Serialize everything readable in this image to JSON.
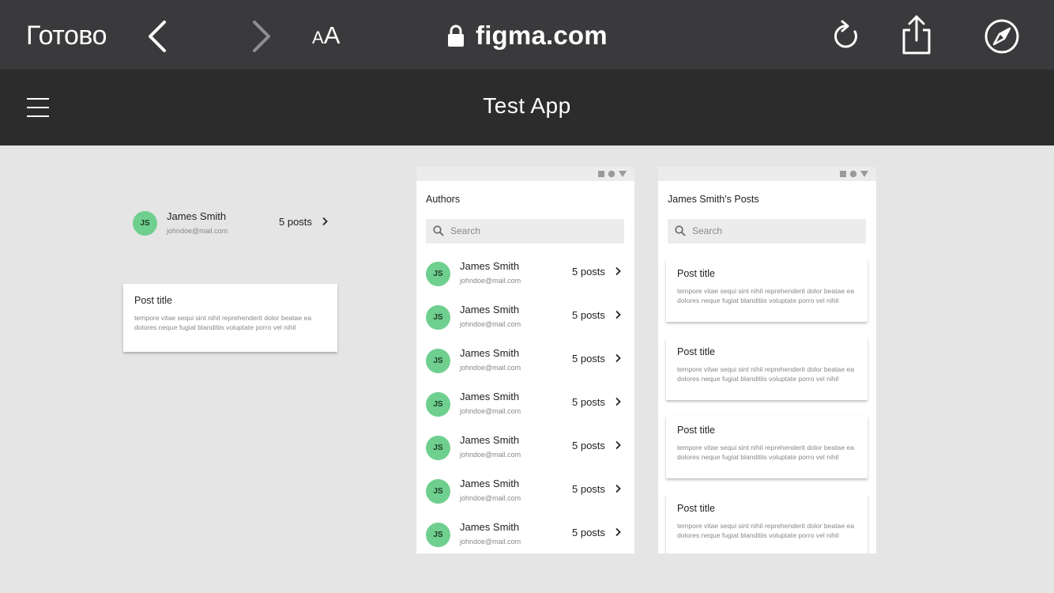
{
  "browser": {
    "done_label": "Готово",
    "text_size_small": "A",
    "text_size_big": "A",
    "url": "figma.com"
  },
  "app": {
    "title": "Test App"
  },
  "components": {
    "author": {
      "initials": "JS",
      "name": "James Smith",
      "email": "johndoe@mail.com",
      "posts": "5 posts"
    },
    "post": {
      "title": "Post title",
      "body": "tempore vitae sequi sint nihil reprehenderit dolor beatae ea dolores neque fugiat blanditiis voluptate porro vel nihil"
    }
  },
  "authors_screen": {
    "title": "Authors",
    "search_placeholder": "Search",
    "items": [
      {
        "initials": "JS",
        "name": "James Smith",
        "email": "johndoe@mail.com",
        "posts": "5 posts"
      },
      {
        "initials": "JS",
        "name": "James Smith",
        "email": "johndoe@mail.com",
        "posts": "5 posts"
      },
      {
        "initials": "JS",
        "name": "James Smith",
        "email": "johndoe@mail.com",
        "posts": "5 posts"
      },
      {
        "initials": "JS",
        "name": "James Smith",
        "email": "johndoe@mail.com",
        "posts": "5 posts"
      },
      {
        "initials": "JS",
        "name": "James Smith",
        "email": "johndoe@mail.com",
        "posts": "5 posts"
      },
      {
        "initials": "JS",
        "name": "James Smith",
        "email": "johndoe@mail.com",
        "posts": "5 posts"
      },
      {
        "initials": "JS",
        "name": "James Smith",
        "email": "johndoe@mail.com",
        "posts": "5 posts"
      }
    ]
  },
  "posts_screen": {
    "title": "James Smith's Posts",
    "search_placeholder": "Search",
    "posts": [
      {
        "title": "Post title",
        "body": "tempore vitae sequi sint nihil reprehenderit dolor beatae ea dolores neque fugiat blanditiis voluptate porro vel nihil"
      },
      {
        "title": "Post title",
        "body": "tempore vitae sequi sint nihil reprehenderit dolor beatae ea dolores neque fugiat blanditiis voluptate porro vel nihil"
      },
      {
        "title": "Post title",
        "body": "tempore vitae sequi sint nihil reprehenderit dolor beatae ea dolores neque fugiat blanditiis voluptate porro vel nihil"
      },
      {
        "title": "Post title",
        "body": "tempore vitae sequi sint nihil reprehenderit dolor beatae ea dolores neque fugiat blanditiis voluptate porro vel nihil"
      }
    ]
  },
  "colors": {
    "toolbar": "#3a3a3d",
    "app_header": "#2c2c2c",
    "canvas": "#e5e5e5",
    "avatar": "#6fcf8f"
  },
  "icons": [
    "back-icon",
    "forward-icon",
    "lock-icon",
    "reload-icon",
    "share-icon",
    "compass-icon",
    "menu-icon",
    "search-icon",
    "chevron-right-icon"
  ]
}
